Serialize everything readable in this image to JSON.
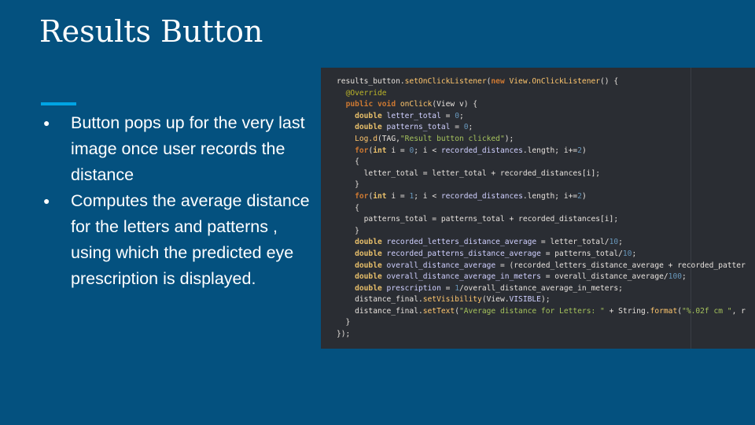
{
  "slide": {
    "title": "Results Button",
    "bullets": [
      "Button pops up for the very last image once user records the distance",
      "Computes the average distance for the letters and patterns , using which the predicted eye prescription is displayed."
    ]
  },
  "code": {
    "lines": [
      [
        [
          "results_button.",
          "pl"
        ],
        [
          "setOnClickListener",
          "fn"
        ],
        [
          "(",
          "pl"
        ],
        [
          "new ",
          "kw"
        ],
        [
          "View.OnClickListener",
          "fn"
        ],
        [
          "() {",
          "pl"
        ]
      ],
      [
        [
          "  ",
          "pl"
        ],
        [
          "@Override",
          "an"
        ]
      ],
      [
        [
          "  ",
          "pl"
        ],
        [
          "public void ",
          "kw"
        ],
        [
          "onClick",
          "fn"
        ],
        [
          "(View v) {",
          "pl"
        ]
      ],
      [
        [
          "    ",
          "pl"
        ],
        [
          "double ",
          "tp"
        ],
        [
          "letter_total",
          "vr"
        ],
        [
          " = ",
          "pl"
        ],
        [
          "0",
          "nm"
        ],
        [
          ";",
          "pl"
        ]
      ],
      [
        [
          "    ",
          "pl"
        ],
        [
          "double ",
          "tp"
        ],
        [
          "patterns_total",
          "vr"
        ],
        [
          " = ",
          "pl"
        ],
        [
          "0",
          "nm"
        ],
        [
          ";",
          "pl"
        ]
      ],
      [
        [
          "    ",
          "pl"
        ],
        [
          "Log.d",
          "fn"
        ],
        [
          "(TAG,",
          "pl"
        ],
        [
          "\"Result button clicked\"",
          "st"
        ],
        [
          ");",
          "pl"
        ]
      ],
      [
        [
          "    ",
          "pl"
        ],
        [
          "for",
          "kw"
        ],
        [
          "(",
          "pl"
        ],
        [
          "int ",
          "tp"
        ],
        [
          "i = ",
          "pl"
        ],
        [
          "0",
          "nm"
        ],
        [
          "; i < ",
          "pl"
        ],
        [
          "recorded_distances",
          "vr"
        ],
        [
          ".length; i+=",
          "pl"
        ],
        [
          "2",
          "nm"
        ],
        [
          ")",
          "pl"
        ]
      ],
      [
        [
          "    {",
          "pl"
        ]
      ],
      [
        [
          "      letter_total = letter_total + recorded_distances[i];",
          "pl"
        ]
      ],
      [
        [
          "    }",
          "pl"
        ]
      ],
      [
        [
          "    ",
          "pl"
        ],
        [
          "for",
          "kw"
        ],
        [
          "(",
          "pl"
        ],
        [
          "int ",
          "tp"
        ],
        [
          "i = ",
          "pl"
        ],
        [
          "1",
          "nm"
        ],
        [
          "; i < ",
          "pl"
        ],
        [
          "recorded_distances",
          "vr"
        ],
        [
          ".length; i+=",
          "pl"
        ],
        [
          "2",
          "nm"
        ],
        [
          ")",
          "pl"
        ]
      ],
      [
        [
          "    {",
          "pl"
        ]
      ],
      [
        [
          "      patterns_total = patterns_total + recorded_distances[i];",
          "pl"
        ]
      ],
      [
        [
          "    }",
          "pl"
        ]
      ],
      [
        [
          "    ",
          "pl"
        ],
        [
          "double ",
          "tp"
        ],
        [
          "recorded_letters_distance_average",
          "vr"
        ],
        [
          " = letter_total/",
          "pl"
        ],
        [
          "10",
          "nm"
        ],
        [
          ";",
          "pl"
        ]
      ],
      [
        [
          "    ",
          "pl"
        ],
        [
          "double ",
          "tp"
        ],
        [
          "recorded_patterns_distance_average",
          "vr"
        ],
        [
          " = patterns_total/",
          "pl"
        ],
        [
          "10",
          "nm"
        ],
        [
          ";",
          "pl"
        ]
      ],
      [
        [
          "    ",
          "pl"
        ],
        [
          "double ",
          "tp"
        ],
        [
          "overall_distance_average",
          "vr"
        ],
        [
          " = (recorded_letters_distance_average + recorded_patter",
          "pl"
        ]
      ],
      [
        [
          "    ",
          "pl"
        ],
        [
          "double ",
          "tp"
        ],
        [
          "overall_distance_average_in_meters",
          "vr"
        ],
        [
          " = overall_distance_average/",
          "pl"
        ],
        [
          "100",
          "nm"
        ],
        [
          ";",
          "pl"
        ]
      ],
      [
        [
          "    ",
          "pl"
        ],
        [
          "double ",
          "tp"
        ],
        [
          "prescription",
          "vr"
        ],
        [
          " = ",
          "pl"
        ],
        [
          "1",
          "nm"
        ],
        [
          "/overall_distance_average_in_meters;",
          "pl"
        ]
      ],
      [
        [
          "    distance_final.",
          "pl"
        ],
        [
          "setVisibility",
          "fn"
        ],
        [
          "(View.",
          "pl"
        ],
        [
          "VISIBLE",
          "vr"
        ],
        [
          ");",
          "pl"
        ]
      ],
      [
        [
          "    distance_final.",
          "pl"
        ],
        [
          "setText",
          "fn"
        ],
        [
          "(",
          "pl"
        ],
        [
          "\"Average distance for Letters: \"",
          "st"
        ],
        [
          " + String.",
          "pl"
        ],
        [
          "format",
          "fn"
        ],
        [
          "(",
          "pl"
        ],
        [
          "\"%.02f cm \"",
          "st"
        ],
        [
          ", r",
          "pl"
        ]
      ],
      [
        [
          "  }",
          "pl"
        ]
      ],
      [
        [
          "});",
          "pl"
        ]
      ]
    ]
  }
}
